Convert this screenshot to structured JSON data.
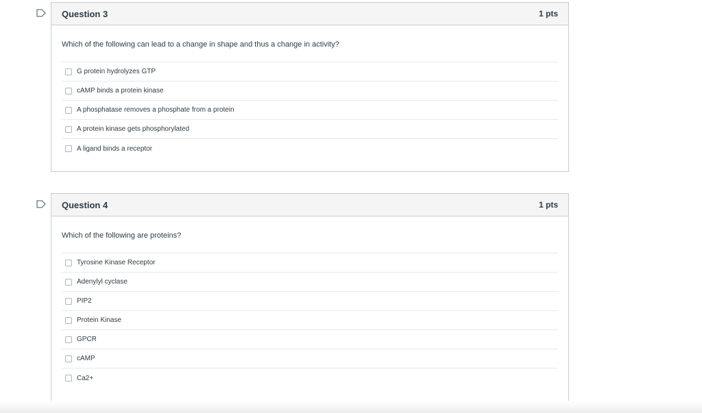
{
  "questions": [
    {
      "title": "Question 3",
      "points": "1 pts",
      "text": "Which of the following can lead to a change in shape and thus a change in activity?",
      "answers": [
        "G protein hydrolyzes GTP",
        "cAMP binds a protein kinase",
        "A phosphatase removes a phosphate from a protein",
        "A protein kinase gets phosphorylated",
        "A ligand binds a receptor"
      ]
    },
    {
      "title": "Question 4",
      "points": "1 pts",
      "text": "Which of the following are proteins?",
      "answers": [
        "Tyrosine Kinase Receptor",
        "Adenylyl cyclase",
        "PIP2",
        "Protein Kinase",
        "GPCR",
        "cAMP",
        "Ca2+"
      ]
    }
  ],
  "icons": {
    "flag": "flag-icon",
    "checkbox": "checkbox"
  },
  "colors": {
    "border": "#c7cdd1",
    "header_bg": "#f5f5f5",
    "text": "#2d3b45"
  }
}
